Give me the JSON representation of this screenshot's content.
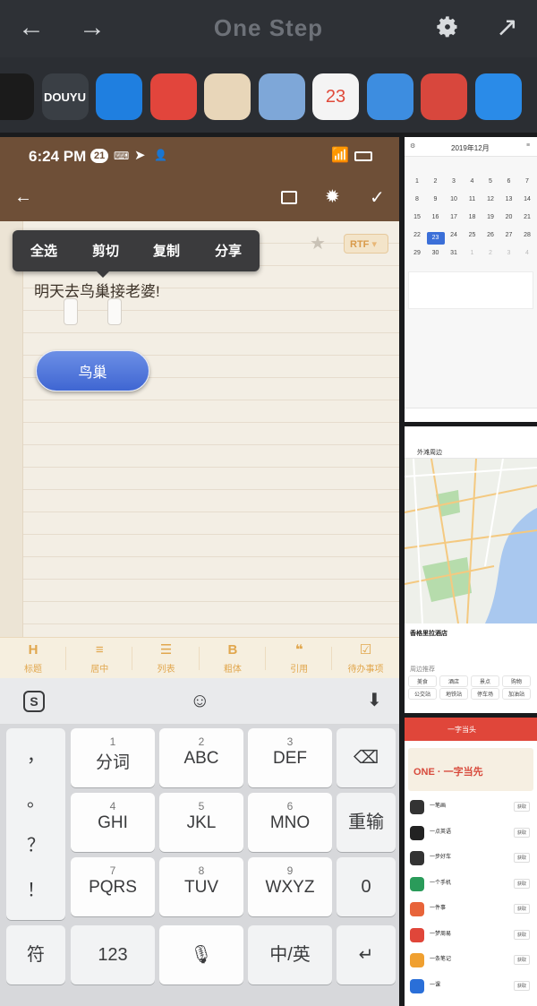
{
  "launcher": {
    "title": "One Step",
    "back_icon": "arrow-left-icon",
    "forward_icon": "arrow-right-icon",
    "settings_icon": "gear-icon",
    "expand_icon": "arrow-up-right-icon"
  },
  "dock": {
    "apps": [
      {
        "name": "qq-icon",
        "label": "",
        "color": "#1b1b1b"
      },
      {
        "name": "douyu-icon",
        "label": "DOUYU",
        "color": "#3a3f45"
      },
      {
        "name": "dog-app-icon",
        "label": "",
        "color": "#1f7fe0"
      },
      {
        "name": "weibo-icon",
        "label": "",
        "color": "#e2453c"
      },
      {
        "name": "notepad-icon",
        "label": "",
        "color": "#e8d6b9"
      },
      {
        "name": "stamp-icon",
        "label": "",
        "color": "#7ea7d8"
      },
      {
        "name": "calendar-icon",
        "label": "23",
        "color": "#f4f4f4"
      },
      {
        "name": "maps-icon",
        "label": "",
        "color": "#3d8de0"
      },
      {
        "name": "store-icon",
        "label": "",
        "color": "#d8473d"
      },
      {
        "name": "browser-icon",
        "label": "",
        "color": "#2a8be8"
      }
    ]
  },
  "status": {
    "time": "6:24 PM",
    "badge": "21"
  },
  "note": {
    "text": "明天去鸟巢接老婆!",
    "chip": "鸟巢",
    "rtf": "RTF",
    "context_menu": [
      "全选",
      "剪切",
      "复制",
      "分享"
    ]
  },
  "format_bar": [
    {
      "icon": "H",
      "label": "标题",
      "name": "format-heading"
    },
    {
      "icon": "≡",
      "label": "居中",
      "name": "format-center"
    },
    {
      "icon": "☰",
      "label": "列表",
      "name": "format-list"
    },
    {
      "icon": "B",
      "label": "粗体",
      "name": "format-bold"
    },
    {
      "icon": "❝",
      "label": "引用",
      "name": "format-quote"
    },
    {
      "icon": "☑",
      "label": "待办事项",
      "name": "format-todo"
    }
  ],
  "keyboard": {
    "left_col": [
      "，",
      "。",
      "？",
      "！"
    ],
    "rows": [
      [
        {
          "num": "1",
          "label": "分词"
        },
        {
          "num": "2",
          "label": "ABC"
        },
        {
          "num": "3",
          "label": "DEF"
        }
      ],
      [
        {
          "num": "4",
          "label": "GHI"
        },
        {
          "num": "5",
          "label": "JKL"
        },
        {
          "num": "6",
          "label": "MNO"
        }
      ],
      [
        {
          "num": "7",
          "label": "PQRS"
        },
        {
          "num": "8",
          "label": "TUV"
        },
        {
          "num": "9",
          "label": "WXYZ"
        }
      ]
    ],
    "right_col": [
      "重输",
      "0"
    ],
    "bottom": {
      "symbol": "符",
      "numbers": "123",
      "lang": "中/英"
    }
  },
  "calendar": {
    "month": "2019年12月",
    "weeks": [
      [
        "1",
        "2",
        "3",
        "4",
        "5",
        "6",
        "7"
      ],
      [
        "8",
        "9",
        "10",
        "11",
        "12",
        "13",
        "14"
      ],
      [
        "15",
        "16",
        "17",
        "18",
        "19",
        "20",
        "21"
      ],
      [
        "22",
        "23",
        "24",
        "25",
        "26",
        "27",
        "28"
      ],
      [
        "29",
        "30",
        "31",
        "1",
        "2",
        "3",
        "4"
      ]
    ]
  },
  "map": {
    "search": "外滩周边",
    "place": "香格里拉酒店",
    "nearby_label": "周边推荐",
    "tags": [
      "美食",
      "酒店",
      "景点",
      "购物",
      "公交站",
      "地铁站",
      "停车场",
      "加油站"
    ]
  },
  "store": {
    "header": "一字当头",
    "banner": "ONE · 一字当先",
    "apps": [
      "一笔画",
      "一点英语",
      "一步好车",
      "一个手机",
      "一件事",
      "一梦周易",
      "一条笔记",
      "一课"
    ],
    "action": "获取"
  }
}
